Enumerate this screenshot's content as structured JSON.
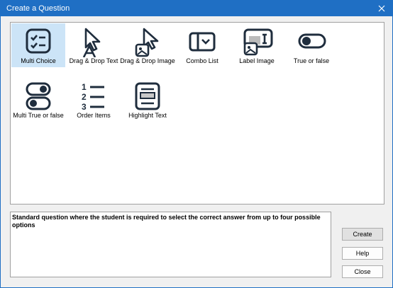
{
  "window": {
    "title": "Create a Question"
  },
  "question_types": [
    {
      "label": "Multi Choice",
      "icon": "multi-choice-icon",
      "selected": true
    },
    {
      "label": "Drag & Drop Text",
      "icon": "drag-drop-text-icon"
    },
    {
      "label": "Drag & Drop Image",
      "icon": "drag-drop-image-icon"
    },
    {
      "label": "Combo List",
      "icon": "combo-list-icon"
    },
    {
      "label": "Label Image",
      "icon": "label-image-icon"
    },
    {
      "label": "True or false",
      "icon": "toggle-icon"
    },
    {
      "label": "Multi True or false",
      "icon": "multi-toggle-icon"
    },
    {
      "label": "Order Items",
      "icon": "ordered-list-icon"
    },
    {
      "label": "Highlight Text",
      "icon": "highlight-text-icon"
    }
  ],
  "description": "Standard question where the student is required to select the correct answer from up to four possible options",
  "buttons": {
    "create": "Create",
    "help": "Help",
    "close": "Close"
  },
  "colors": {
    "titlebar": "#1f6fc4",
    "icon_stroke": "#1f2d3d",
    "selection": "#cce4f7"
  }
}
